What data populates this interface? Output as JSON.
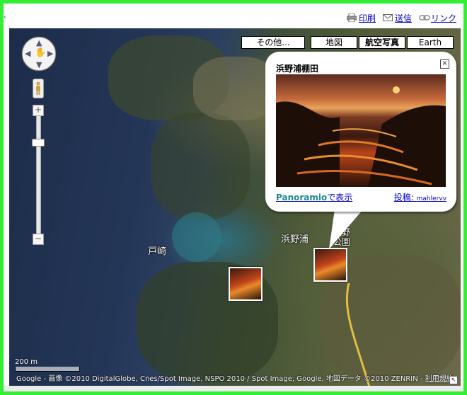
{
  "links": {
    "print": "印刷",
    "send": "送信",
    "link": "リンク"
  },
  "maptypes": {
    "other": "その他...",
    "map": "地図",
    "satellite": "航空写真",
    "earth": "Earth"
  },
  "zoom": {
    "plus": "+",
    "minus": "−"
  },
  "labels": {
    "tozaki": "戸崎",
    "hamanoura": "浜野浦",
    "hamano_park": "浜野",
    "park_suffix": "公園"
  },
  "bubble": {
    "title": "浜野浦棚田",
    "close": "×",
    "panoramio_brand": "Panoramio",
    "panoramio_link": "で表示",
    "post_label": "投稿: ",
    "post_user": "mahlervv"
  },
  "scale": "200 m",
  "copyright_prefix": "Google - 画像 ©2010 DigitalGlobe, Cnes/Spot Image, NSPO 2010 / Spot Image, Google, 地図データ ©2010 ZENRIN - ",
  "terms": "利用規約"
}
